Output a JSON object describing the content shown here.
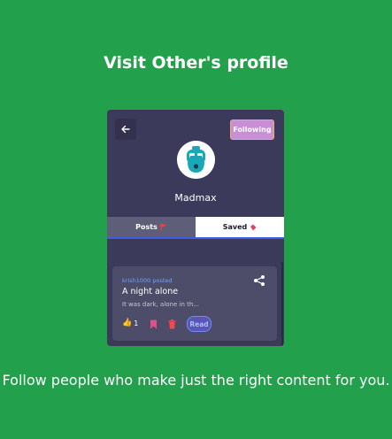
{
  "headline": "Visit Other's profile",
  "profile": {
    "follow_label": "Following",
    "username": "Madmax"
  },
  "tabs": [
    {
      "label": "Posts",
      "icon": "flag-icon",
      "active": false
    },
    {
      "label": "Saved",
      "icon": "bookmark-icon",
      "active": true
    }
  ],
  "post": {
    "author": "krish1000 posted",
    "title": "A night alone",
    "excerpt": "It was dark, alone in th...",
    "likes": "1",
    "read_label": "Read"
  },
  "footer": "Follow people who make just the right content for you.",
  "colors": {
    "background": "#22a04c",
    "card": "#3c3a5a",
    "accent_blue": "#3b5fe0",
    "follow_button": "#c98fd6"
  }
}
